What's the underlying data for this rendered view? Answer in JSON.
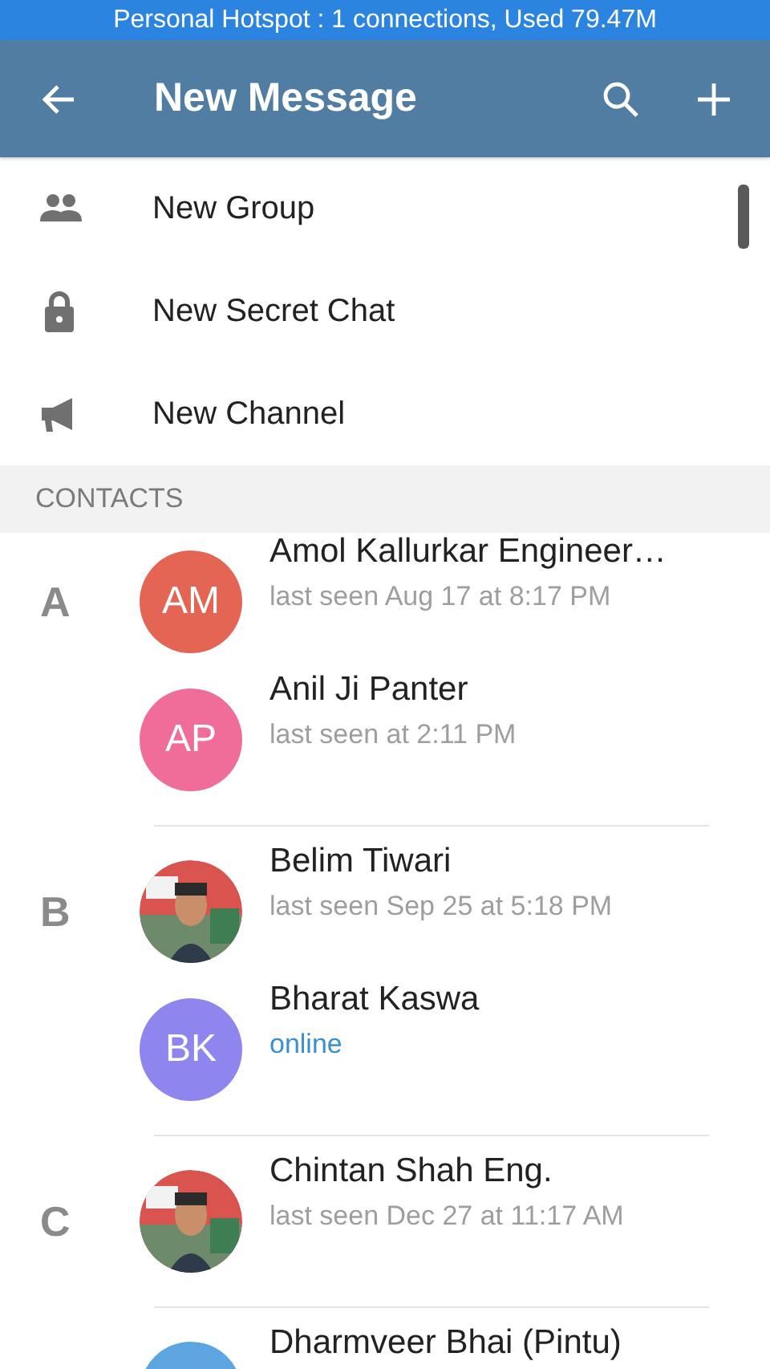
{
  "status_bar": {
    "text": "Personal Hotspot : 1 connections, Used 79.47M"
  },
  "header": {
    "title": "New Message"
  },
  "actions": [
    {
      "kind": "group",
      "label": "New Group"
    },
    {
      "kind": "secret",
      "label": "New Secret Chat"
    },
    {
      "kind": "channel",
      "label": "New Channel"
    }
  ],
  "section_header": "CONTACTS",
  "contacts": [
    {
      "letter": "A",
      "entries": [
        {
          "name": "Amol Kallurkar Engineer…",
          "status": "last seen Aug 17 at 8:17 PM",
          "online": false,
          "avatar": {
            "kind": "initials",
            "initials": "AM",
            "color": "#e56555"
          }
        },
        {
          "name": "Anil Ji Panter",
          "status": "last seen at 2:11 PM",
          "online": false,
          "avatar": {
            "kind": "initials",
            "initials": "AP",
            "color": "#f06d99"
          }
        }
      ]
    },
    {
      "letter": "B",
      "entries": [
        {
          "name": "Belim Tiwari",
          "status": "last seen Sep 25 at 5:18 PM",
          "online": false
        },
        {
          "name": "Bharat Kaswa",
          "status": "online",
          "online": true,
          "avatar": {
            "kind": "initials",
            "initials": "BK",
            "color": "#8e85ee"
          }
        }
      ]
    },
    {
      "letter": "C",
      "entries": [
        {
          "name": "Chintan Shah Eng.",
          "status": "last seen Dec 27 at 11:17 AM",
          "online": false
        }
      ]
    },
    {
      "entries": [
        {
          "name": "Dharmveer Bhai (Pintu)",
          "avatar": {
            "kind": "plain",
            "color": "#5ca5e0"
          }
        }
      ]
    }
  ]
}
